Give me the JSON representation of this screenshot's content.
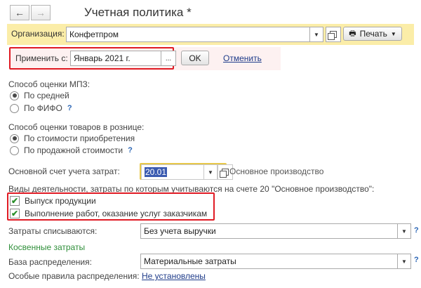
{
  "header": {
    "back_icon": "arrow-left-icon",
    "forward_icon": "arrow-right-icon",
    "back_glyph": "←",
    "forward_glyph": "→",
    "title": "Учетная политика *"
  },
  "org": {
    "label": "Организация:",
    "value": "Конфетпром",
    "print_label": "Печать"
  },
  "apply": {
    "label": "Применить с:",
    "value": "Январь 2021 г.",
    "select_glyph": "...",
    "ok_label": "OK",
    "cancel_label": "Отменить"
  },
  "mpz": {
    "title": "Способ оценки МПЗ:",
    "options": [
      {
        "label": "По средней",
        "selected": true,
        "help": ""
      },
      {
        "label": "По ФИФО",
        "selected": false,
        "help": "?"
      }
    ]
  },
  "retail": {
    "title": "Способ оценки товаров в рознице:",
    "options": [
      {
        "label": "По стоимости приобретения",
        "selected": true,
        "help": ""
      },
      {
        "label": "По продажной стоимости",
        "selected": false,
        "help": "?"
      }
    ]
  },
  "account": {
    "label": "Основной счет учета затрат:",
    "value": "20.01",
    "description": "Основное производство"
  },
  "activities": {
    "title": "Виды деятельности, затраты по которым учитываются на счете 20 \"Основное производство\":",
    "items": [
      {
        "label": "Выпуск продукции",
        "checked": true
      },
      {
        "label": "Выполнение работ, оказание услуг заказчикам",
        "checked": true
      }
    ]
  },
  "writeoff": {
    "label": "Затраты списываются:",
    "value": "Без учета выручки",
    "help": "?"
  },
  "indirect": {
    "title": "Косвенные затраты",
    "base_label": "База распределения:",
    "base_value": "Материальные затраты",
    "base_help": "?",
    "rules_label": "Особые правила распределения:",
    "rules_link": "Не установлены"
  },
  "colors": {
    "highlight_bar": "#fbeda8",
    "red_frame": "#e01b24",
    "focus_frame": "#e8c84a",
    "link": "#1f3c8a",
    "green_text": "#2f8f3a"
  }
}
